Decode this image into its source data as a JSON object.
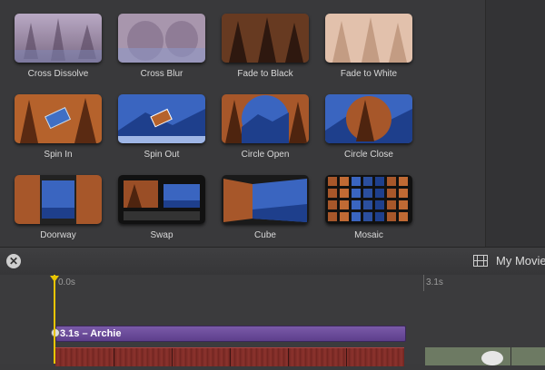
{
  "transitions": [
    {
      "label": "Cross Dissolve"
    },
    {
      "label": "Cross Blur"
    },
    {
      "label": "Fade to Black"
    },
    {
      "label": "Fade to White"
    },
    {
      "label": "Spin In"
    },
    {
      "label": "Spin Out"
    },
    {
      "label": "Circle Open"
    },
    {
      "label": "Circle Close"
    },
    {
      "label": "Doorway"
    },
    {
      "label": "Swap"
    },
    {
      "label": "Cube"
    },
    {
      "label": "Mosaic"
    }
  ],
  "toolbar": {
    "close_symbol": "✕",
    "movie_title": "My Movie"
  },
  "timeline": {
    "ruler_labels": [
      "0.0s",
      "3.1s"
    ],
    "title_clip_label": "3.1s – Archie"
  },
  "colors": {
    "playhead": "#e8c500",
    "title_clip": "#6b4c9a"
  }
}
